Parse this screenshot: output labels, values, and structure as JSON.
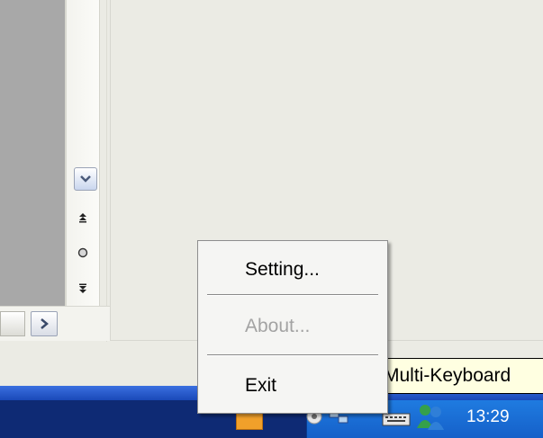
{
  "context_menu": {
    "items": [
      {
        "label": "Setting...",
        "enabled": true
      },
      {
        "label": "About...",
        "enabled": false
      },
      {
        "label": "Exit",
        "enabled": true
      }
    ]
  },
  "tooltip": {
    "text": "Multi-Keyboard"
  },
  "taskbar": {
    "clock": "13:29"
  },
  "colors": {
    "taskbar": "#1f5cc4",
    "tooltip_bg": "#ffffe1",
    "menu_bg": "#f5f5f3",
    "disabled_text": "#a3a3a3"
  },
  "icons": [
    "chevron-down-icon",
    "previous-page-icon",
    "select-browse-object-icon",
    "next-page-icon",
    "scroll-right-icon",
    "network-icon",
    "keyboard-icon",
    "messenger-icon"
  ]
}
